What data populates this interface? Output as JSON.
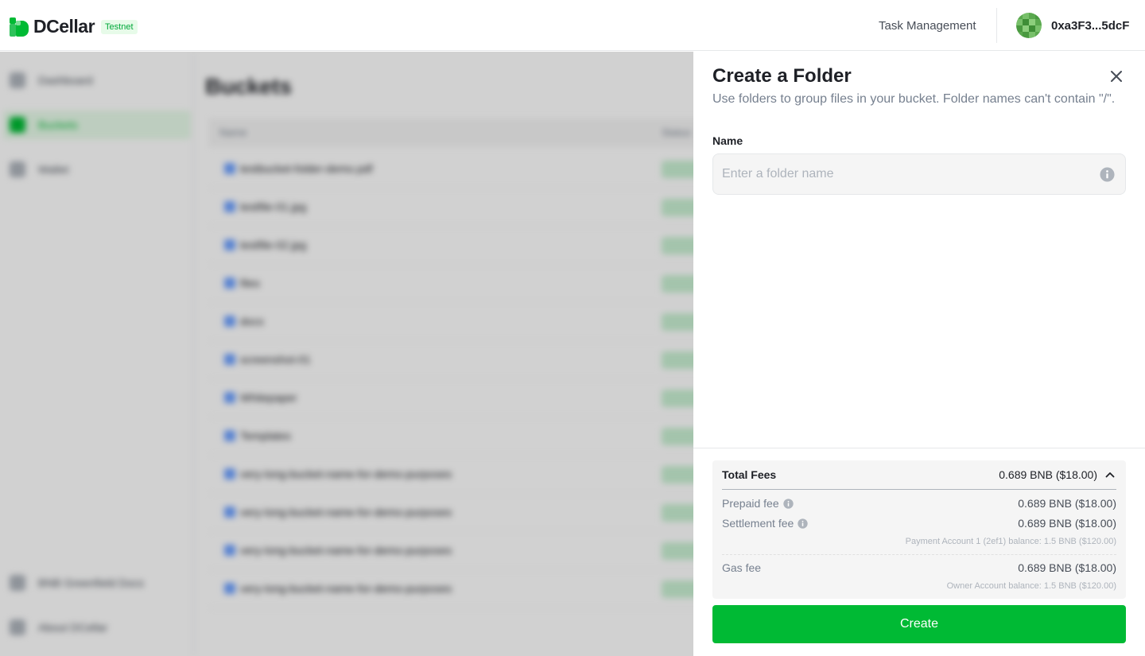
{
  "header": {
    "brand": "DCellar",
    "badge": "Testnet",
    "task_management": "Task Management",
    "address": "0xa3F3...5dcF"
  },
  "background": {
    "sidebar_items": [
      "Dashboard",
      "Buckets",
      "Wallet"
    ],
    "sidebar_bottom": [
      "BNB Greenfield Docs",
      "About DCellar"
    ],
    "page_title": "Buckets",
    "columns": [
      "Name",
      "Status"
    ],
    "rows": [
      "testbucket-folder-demo.pdf",
      "testfile-01.jpg",
      "testfile-02.jpg",
      "files",
      "docs",
      "screenshot-01",
      "Whitepaper",
      "Templates",
      "very-long-bucket-name-for-demo-purposes",
      "very-long-bucket-name-for-demo-purposes",
      "very-long-bucket-name-for-demo-purposes",
      "very-long-bucket-name-for-demo-purposes"
    ]
  },
  "drawer": {
    "title": "Create a Folder",
    "description": "Use folders to group files in your bucket. Folder names can't contain \"/\".",
    "name_label": "Name",
    "name_placeholder": "Enter a folder name",
    "name_value": "",
    "fees": {
      "total_label": "Total Fees",
      "total_value": "0.689 BNB ($18.00)",
      "prepaid_label": "Prepaid fee",
      "prepaid_value": "0.689 BNB ($18.00)",
      "settlement_label": "Settlement fee",
      "settlement_value": "0.689 BNB ($18.00)",
      "payment_balance": "Payment Account 1 (2ef1) balance: 1.5 BNB ($120.00)",
      "gas_label": "Gas fee",
      "gas_value": "0.689 BNB ($18.00)",
      "owner_balance": "Owner Account balance: 1.5 BNB ($120.00)"
    },
    "create_label": "Create"
  },
  "colors": {
    "brand_green": "#00ba34",
    "text_primary": "#1e2026",
    "text_secondary": "#76808f"
  }
}
